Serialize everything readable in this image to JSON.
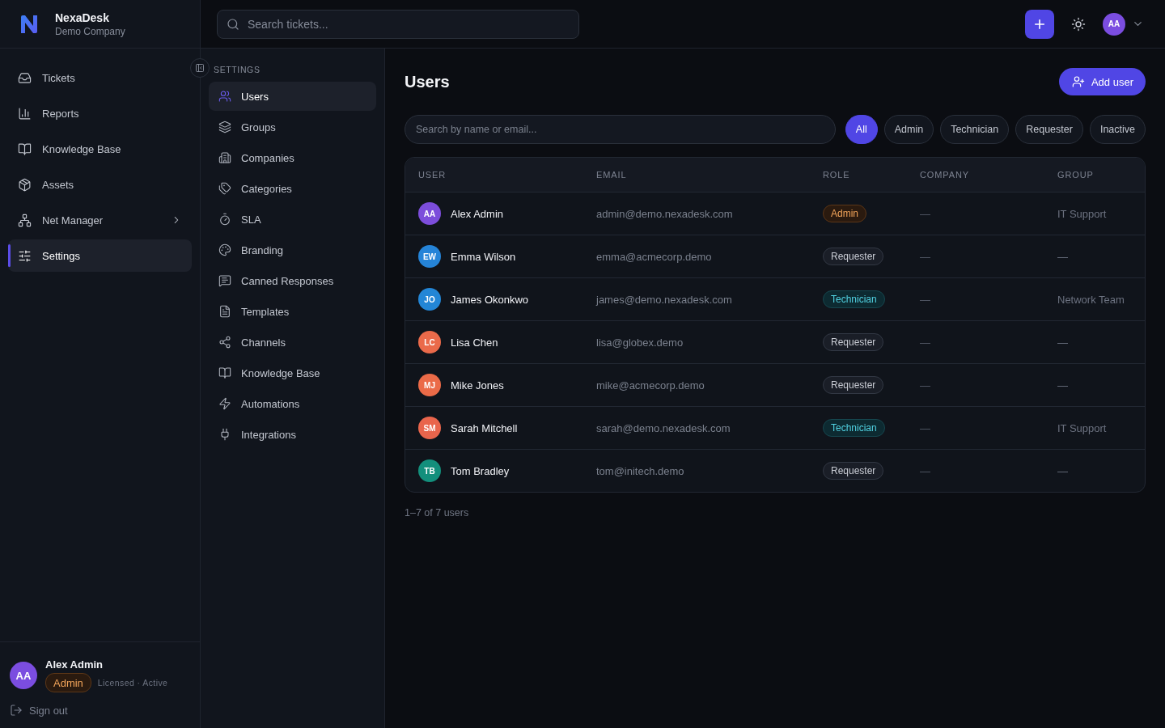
{
  "brand": {
    "name": "NexaDesk",
    "company": "Demo Company"
  },
  "nav": [
    {
      "label": "Tickets",
      "kind": "link",
      "selected": false
    },
    {
      "label": "Reports",
      "kind": "link",
      "selected": false
    },
    {
      "label": "Knowledge Base",
      "kind": "link",
      "selected": false
    },
    {
      "label": "Assets",
      "kind": "link",
      "selected": false
    },
    {
      "label": "Net Manager",
      "kind": "group",
      "selected": false
    },
    {
      "label": "Settings",
      "kind": "link",
      "selected": true
    }
  ],
  "current_user": {
    "initials": "AA",
    "name": "Alex Admin",
    "role": {
      "label": "Admin",
      "kind": "admin"
    },
    "status": "Licensed · Active"
  },
  "sign_out": "Sign out",
  "topbar": {
    "search": {
      "placeholder": "Search tickets..."
    },
    "avatar": "AA"
  },
  "settings_nav": {
    "title": "SETTINGS",
    "items": [
      {
        "label": "Users",
        "selected": true
      },
      {
        "label": "Groups",
        "selected": false
      },
      {
        "label": "Companies",
        "selected": false
      },
      {
        "label": "Categories",
        "selected": false
      },
      {
        "label": "SLA",
        "selected": false
      },
      {
        "label": "Branding",
        "selected": false
      },
      {
        "label": "Canned Responses",
        "selected": false
      },
      {
        "label": "Templates",
        "selected": false
      },
      {
        "label": "Channels",
        "selected": false
      },
      {
        "label": "Knowledge Base",
        "selected": false
      },
      {
        "label": "Automations",
        "selected": false
      },
      {
        "label": "Integrations",
        "selected": false
      }
    ]
  },
  "page": {
    "title": "Users",
    "add_button": "Add user",
    "search": {
      "placeholder": "Search by name or email..."
    },
    "filters": [
      {
        "label": "All",
        "selected": true
      },
      {
        "label": "Admin",
        "selected": false
      },
      {
        "label": "Technician",
        "selected": false
      },
      {
        "label": "Requester",
        "selected": false
      },
      {
        "label": "Inactive",
        "selected": false
      }
    ]
  },
  "table": {
    "columns": [
      "USER",
      "EMAIL",
      "ROLE",
      "COMPANY",
      "GROUP"
    ],
    "rows": [
      {
        "initials": "AA",
        "color": "#7c4ddb",
        "name": "Alex Admin",
        "email": "admin@demo.nexadesk.com",
        "role": {
          "label": "Admin",
          "kind": "admin"
        },
        "company": "—",
        "group": "IT Support"
      },
      {
        "initials": "EW",
        "color": "#2584d8",
        "name": "Emma Wilson",
        "email": "emma@acmecorp.demo",
        "role": {
          "label": "Requester",
          "kind": "requester"
        },
        "company": "—",
        "group": "—"
      },
      {
        "initials": "JO",
        "color": "#2386d6",
        "name": "James Okonkwo",
        "email": "james@demo.nexadesk.com",
        "role": {
          "label": "Technician",
          "kind": "technician"
        },
        "company": "—",
        "group": "Network Team"
      },
      {
        "initials": "LC",
        "color": "#ea6a4a",
        "name": "Lisa Chen",
        "email": "lisa@globex.demo",
        "role": {
          "label": "Requester",
          "kind": "requester"
        },
        "company": "—",
        "group": "—"
      },
      {
        "initials": "MJ",
        "color": "#eb6b48",
        "name": "Mike Jones",
        "email": "mike@acmecorp.demo",
        "role": {
          "label": "Requester",
          "kind": "requester"
        },
        "company": "—",
        "group": "—"
      },
      {
        "initials": "SM",
        "color": "#e9654c",
        "name": "Sarah Mitchell",
        "email": "sarah@demo.nexadesk.com",
        "role": {
          "label": "Technician",
          "kind": "technician"
        },
        "company": "—",
        "group": "IT Support"
      },
      {
        "initials": "TB",
        "color": "#138f7c",
        "name": "Tom Bradley",
        "email": "tom@initech.demo",
        "role": {
          "label": "Requester",
          "kind": "requester"
        },
        "company": "—",
        "group": "—"
      }
    ]
  },
  "footer": "1–7 of 7 users"
}
